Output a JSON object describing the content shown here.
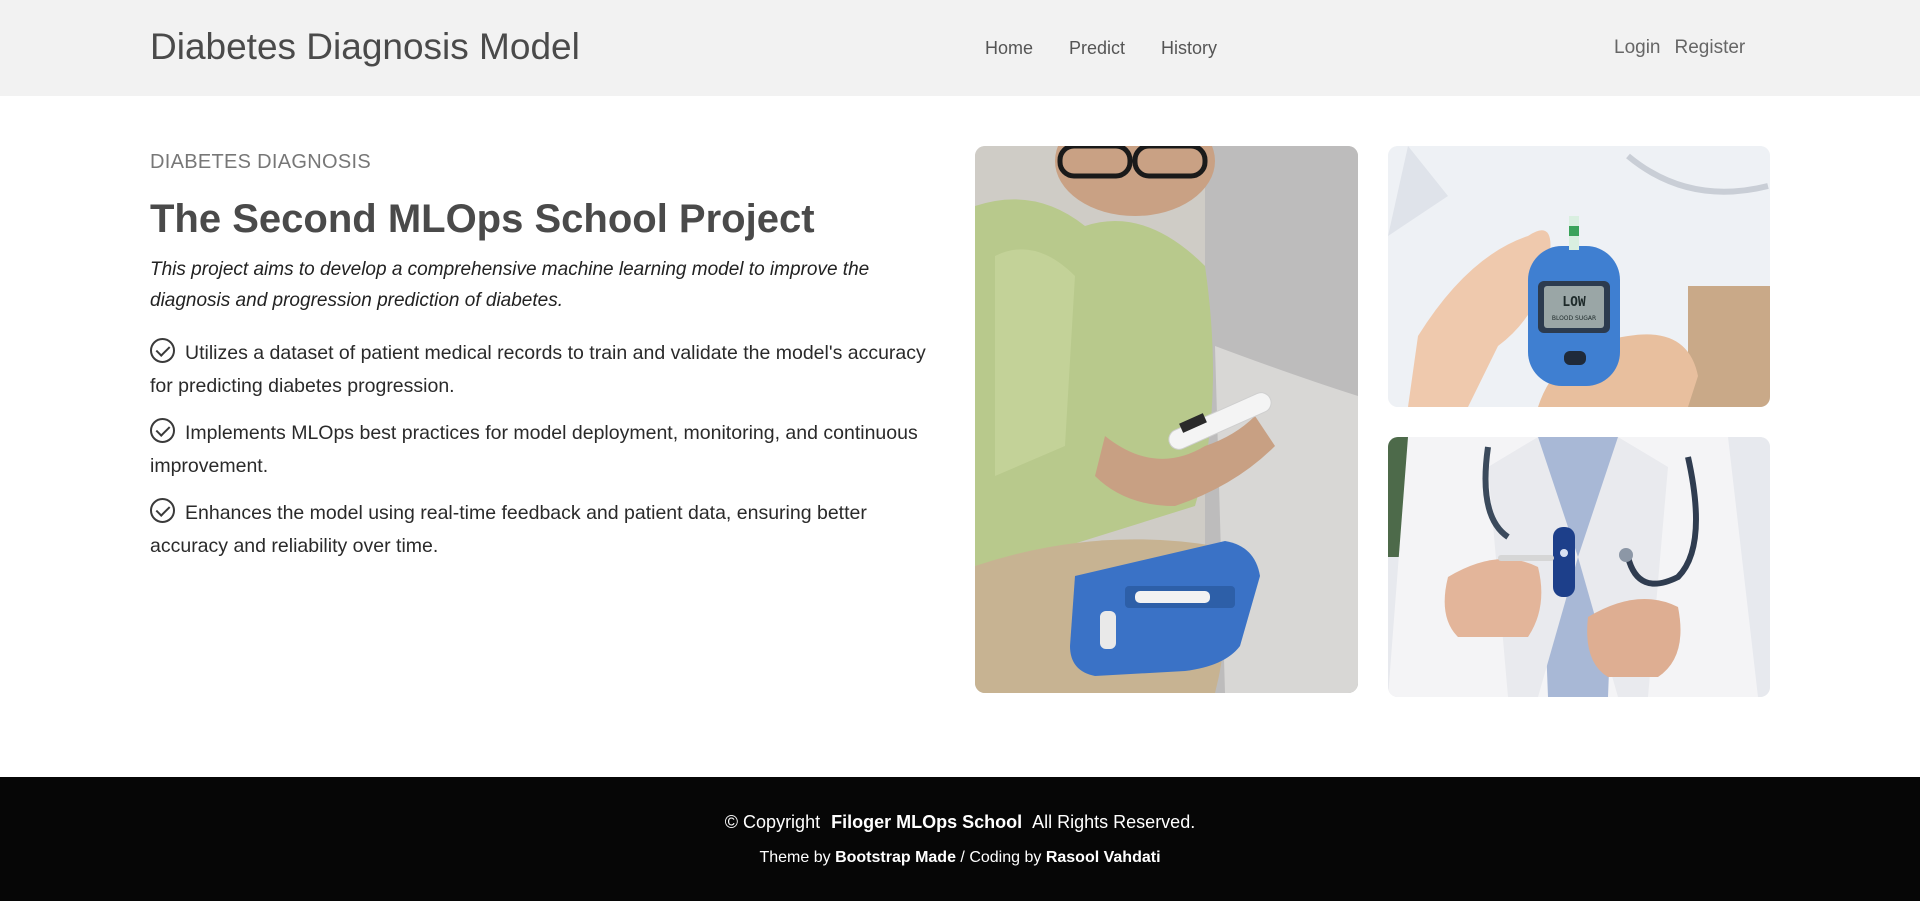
{
  "header": {
    "brand": "Diabetes Diagnosis Model",
    "nav": [
      "Home",
      "Predict",
      "History"
    ],
    "auth": {
      "login": "Login",
      "register": "Register"
    }
  },
  "hero": {
    "eyebrow": "DIABETES DIAGNOSIS",
    "title": "The Second MLOps School Project",
    "lead": "This project aims to develop a comprehensive machine learning model to improve the diagnosis and progression prediction of diabetes.",
    "features": [
      "Utilizes a dataset of patient medical records to train and validate the model's accuracy for predicting diabetes progression.",
      "Implements MLOps best practices for model deployment, monitoring, and continuous improvement.",
      "Enhances the model using real-time feedback and patient data, ensuring better accuracy and reliability over time."
    ]
  },
  "images": {
    "meter_display": "LOW",
    "meter_subtext": "BLOOD SUGAR"
  },
  "footer": {
    "copyright_prefix": "© Copyright",
    "org": "Filoger MLOps School",
    "rights": "All Rights Reserved.",
    "theme_prefix": "Theme by",
    "theme_by": "Bootstrap Made",
    "coding_prefix": "/ Coding by",
    "coding_by": "Rasool Vahdati"
  },
  "colors": {
    "header_bg": "#f2f2f2",
    "footer_bg": "#060606",
    "meter_blue": "#3f7fd1"
  }
}
